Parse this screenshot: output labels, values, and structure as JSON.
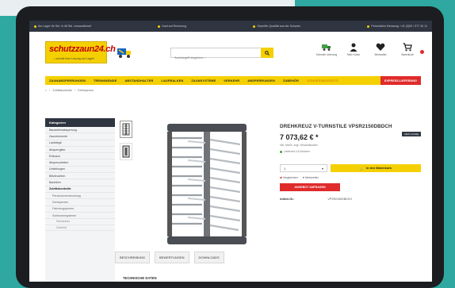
{
  "topbar": {
    "items": [
      "Am Lager für Sie: in 48 Std. versandbereit",
      "Kauf auf Rechnung",
      "Geprüfte Qualität aus der Schweiz",
      "Persönliche Beratung: +41 (0)52 / 577 40 11"
    ]
  },
  "logo": {
    "title": "schutzzaun24.ch",
    "tagline": "... schnell eine Lösung auf Lager!"
  },
  "search": {
    "placeholder": "Suchbegriff eingeben ..."
  },
  "header_icons": [
    {
      "icon": "truck-icon",
      "label": "Schnelle Lieferung"
    },
    {
      "icon": "user-icon",
      "label": "Mein Konto"
    },
    {
      "icon": "heart-icon",
      "label": "Merkzettel"
    },
    {
      "icon": "cart-icon",
      "label": "Warenkorb"
    }
  ],
  "nav": {
    "items": [
      "ZAUNABSPERRUNGEN",
      "TRENNWÄNDE",
      "ABSTANDHALTER",
      "LAUFBALKEN",
      "ZAUNSYSTEME",
      "VERKEHR",
      "ABSPERRUNGEN",
      "ZUBEHÖR"
    ],
    "sale": "SONDERANGEBOTE",
    "express": "EXPRESS-LIEFERUNG"
  },
  "breadcrumb": [
    "Zutrittskontrolle",
    "Drehsperren"
  ],
  "sidebar": {
    "title": "Kategorien",
    "items": [
      {
        "label": "Baustellenabsperrung",
        "level": 0
      },
      {
        "label": "Zaunelemente",
        "level": 0
      },
      {
        "label": "Laufstege",
        "level": 0
      },
      {
        "label": "Absperrgitter",
        "level": 0
      },
      {
        "label": "Rollzaun",
        "level": 0
      },
      {
        "label": "Absperrpfosten",
        "level": 0
      },
      {
        "label": "Umleitungen",
        "level": 0
      },
      {
        "label": "Blitzleuchten",
        "level": 0
      },
      {
        "label": "Baufolien",
        "level": 0
      },
      {
        "label": "Zutrittskontrolle",
        "level": 0
      },
      {
        "label": "Personenvereinzelung",
        "level": 1
      },
      {
        "label": "Drehsperren",
        "level": 1
      },
      {
        "label": "Fahrzeugsperren",
        "level": 1
      },
      {
        "label": "Schleusensysteme",
        "level": 1
      },
      {
        "label": "Schranken",
        "level": 2
      },
      {
        "label": "Zubehör",
        "level": 2
      }
    ]
  },
  "product": {
    "title": "DREHKREUZ V-TURNSTILE VPSR2150DBDCH",
    "badge": "Nicht vorrätig",
    "price": "7 073,62 € *",
    "tax": "inkl. MwSt. zzgl. Versandkosten",
    "delivery": "Lieferzeit 4-6 Wochen",
    "qty": "1",
    "cart_label": "In den Warenkorb",
    "wishlist": "Merkzettel",
    "compare": "Vergleichen",
    "offer_label": "ANGEBOT ANFRAGEN",
    "meta_key": "Artikel-Nr.:",
    "meta_value": "VPSR2150DBDCH"
  },
  "tabs": [
    "BESCHREIBUNG",
    "BEWERTUNGEN",
    "DOWNLOADS"
  ],
  "section_title": "TECHNISCHE DATEN",
  "colors": {
    "accent": "#f5d000",
    "brand_red": "#c40000",
    "dark": "#2e3440",
    "backdrop": "#2ea8a1"
  }
}
